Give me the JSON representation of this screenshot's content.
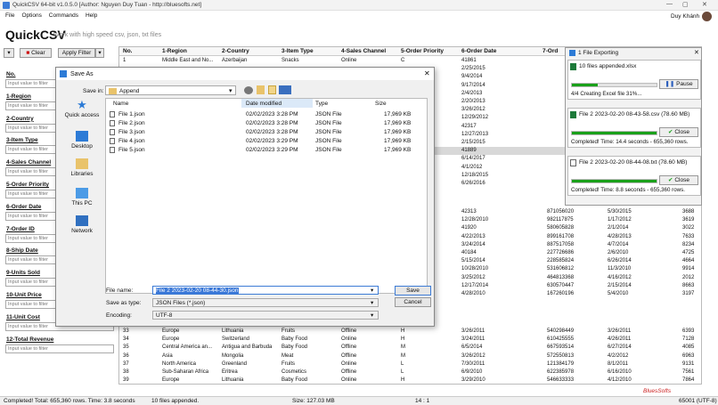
{
  "window": {
    "title": "QuickCSV 64-bit v1.0.5.0 [Author: Nguyen Duy Tuan - http://bluesofts.net]"
  },
  "menu": [
    "File",
    "Options",
    "Commands",
    "Help"
  ],
  "user": {
    "name": "Duy Khánh"
  },
  "app": {
    "brand": "QuickCSV",
    "slogan": "Work with high speed csv, json, txt files"
  },
  "toolbar": {
    "clear": "Clear",
    "apply": "Apply Filter"
  },
  "filters": {
    "placeholder": "Input value to filter",
    "fields": [
      "No.",
      "1-Region",
      "2-Country",
      "3-Item Type",
      "4-Sales Channel",
      "5-Order Priority",
      "6-Order Date",
      "7-Order ID",
      "8-Ship Date",
      "9-Units Sold",
      "10-Unit Price",
      "11-Unit Cost",
      "12-Total Revenue"
    ]
  },
  "grid": {
    "columns": [
      "No.",
      "1-Region",
      "2-Country",
      "3-Item Type",
      "4-Sales Channel",
      "5-Order Priority",
      "6-Order Date",
      "7-Ord"
    ],
    "top_rows": [
      [
        "1",
        "Middle East and No...",
        "Azerbaijan",
        "Snacks",
        "Online",
        "C",
        "41861"
      ],
      [
        "",
        "",
        "",
        "",
        "",
        "",
        "2/25/2015"
      ],
      [
        "",
        "",
        "",
        "",
        "",
        "",
        "9/4/2014"
      ],
      [
        "",
        "",
        "",
        "",
        "",
        "",
        "9/17/2014"
      ],
      [
        "",
        "",
        "",
        "",
        "",
        "",
        "2/4/2013"
      ],
      [
        "",
        "",
        "",
        "",
        "",
        "",
        "2/20/2013"
      ],
      [
        "",
        "",
        "",
        "",
        "",
        "",
        "3/26/2012"
      ],
      [
        "",
        "",
        "",
        "",
        "",
        "",
        "12/29/2012"
      ],
      [
        "",
        "",
        "",
        "",
        "",
        "",
        "42317"
      ],
      [
        "",
        "",
        "",
        "",
        "",
        "",
        "12/27/2013"
      ],
      [
        "",
        "",
        "",
        "",
        "",
        "",
        "2/15/2015"
      ],
      [
        "",
        "",
        "",
        "",
        "",
        "",
        "41889"
      ],
      [
        "",
        "",
        "",
        "",
        "",
        "",
        "6/14/2017"
      ],
      [
        "",
        "",
        "",
        "",
        "",
        "",
        "4/1/2012"
      ],
      [
        "",
        "",
        "",
        "",
        "",
        "",
        "12/18/2015"
      ],
      [
        "",
        "",
        "",
        "",
        "",
        "",
        "6/26/2016"
      ]
    ],
    "mid_rows": [
      [
        "",
        "",
        "",
        "",
        "",
        "",
        "42313",
        "871056020",
        "5/30/2015",
        "3688"
      ],
      [
        "",
        "",
        "",
        "",
        "",
        "",
        "12/28/2010",
        "982117875",
        "1/17/2012",
        "3619"
      ],
      [
        "",
        "",
        "",
        "",
        "",
        "",
        "41920",
        "580605828",
        "2/1/2014",
        "3022"
      ],
      [
        "",
        "",
        "",
        "",
        "",
        "",
        "4/22/2013",
        "899161708",
        "4/28/2013",
        "7633"
      ],
      [
        "",
        "",
        "",
        "",
        "",
        "",
        "3/24/2014",
        "887517058",
        "4/7/2014",
        "8234"
      ],
      [
        "",
        "",
        "",
        "",
        "",
        "",
        "40184",
        "227726686",
        "2/6/2010",
        "4725"
      ],
      [
        "",
        "",
        "",
        "",
        "",
        "",
        "5/15/2014",
        "228585824",
        "6/26/2014",
        "4664"
      ],
      [
        "",
        "",
        "",
        "",
        "",
        "",
        "10/28/2010",
        "531606812",
        "11/3/2010",
        "9914"
      ],
      [
        "",
        "",
        "",
        "",
        "",
        "",
        "3/25/2012",
        "464813368",
        "4/16/2012",
        "2012"
      ],
      [
        "",
        "",
        "",
        "",
        "",
        "",
        "12/17/2014",
        "630570447",
        "2/15/2014",
        "8663"
      ],
      [
        "",
        "",
        "",
        "",
        "",
        "",
        "4/28/2010",
        "167260196",
        "5/4/2010",
        "3197"
      ]
    ],
    "bottom_rows": [
      [
        "33",
        "Europe",
        "Lithuania",
        "Fruits",
        "Offline",
        "H",
        "3/26/2011",
        "540298449",
        "3/26/2011",
        "6393"
      ],
      [
        "34",
        "Europe",
        "Switzerland",
        "Baby Food",
        "Online",
        "H",
        "3/24/2011",
        "610425555",
        "4/26/2011",
        "7128"
      ],
      [
        "35",
        "Central America an...",
        "Antigua and Barbuda",
        "Baby Food",
        "Offline",
        "M",
        "6/5/2014",
        "667593514",
        "6/27/2014",
        "4085"
      ],
      [
        "36",
        "Asia",
        "Mongolia",
        "Meat",
        "Offline",
        "M",
        "3/26/2012",
        "572550813",
        "4/2/2012",
        "6963"
      ],
      [
        "37",
        "North America",
        "Greenland",
        "Fruits",
        "Online",
        "L",
        "7/30/2011",
        "121384179",
        "8/1/2011",
        "9131"
      ],
      [
        "38",
        "Sub-Saharan Africa",
        "Eritrea",
        "Cosmetics",
        "Offline",
        "L",
        "6/9/2010",
        "622385978",
        "6/16/2010",
        "7561"
      ],
      [
        "39",
        "Europe",
        "Lithuania",
        "Baby Food",
        "Online",
        "H",
        "3/29/2010",
        "546633333",
        "4/12/2010",
        "7864"
      ]
    ]
  },
  "status": {
    "completed": "Completed! Total: 655,360 rows. Time: 3.8 seconds",
    "appended": "10 files appended.",
    "size": "Size: 127.03 MB",
    "pos": "14 : 1",
    "enc": "65001 (UTF-8)",
    "watermark": "BluesSofts"
  },
  "dialog": {
    "title": "Save As",
    "save_in_label": "Save in:",
    "save_in": "Append",
    "places": [
      "Quick access",
      "Desktop",
      "Libraries",
      "This PC",
      "Network"
    ],
    "col_name": "Name",
    "col_date": "Date modified",
    "col_type": "Type",
    "col_size": "Size",
    "files": [
      [
        "File 1.json",
        "02/02/2023 3:28 PM",
        "JSON File",
        "17,969 KB"
      ],
      [
        "File 2.json",
        "02/02/2023 3:28 PM",
        "JSON File",
        "17,969 KB"
      ],
      [
        "File 3.json",
        "02/02/2023 3:28 PM",
        "JSON File",
        "17,969 KB"
      ],
      [
        "File 4.json",
        "02/02/2023 3:29 PM",
        "JSON File",
        "17,969 KB"
      ],
      [
        "File 5.json",
        "02/02/2023 3:29 PM",
        "JSON File",
        "17,969 KB"
      ]
    ],
    "filename_label": "File name:",
    "filename": "File 2 2023-02-20 08-44-30.json",
    "type_label": "Save as type:",
    "type": "JSON Files (*.json)",
    "enc_label": "Encoding:",
    "enc": "UTF-8",
    "save": "Save",
    "cancel": "Cancel"
  },
  "export": {
    "title": "1 File Exporting",
    "c1_title": "10 files appended.xlsx",
    "c1_status": "4/4 Creating Excel file 31%...",
    "pause": "Pause",
    "c1_progress": 0.31,
    "c2_title": "File 2 2023-02-20 08-43-58.csv (78.60 MB)",
    "c2_status": "Completed! Time: 14.4 seconds - 655,360 rows.",
    "c2_progress": 1,
    "c3_title": "File 2 2023-02-20 08-44-08.txt (78.60 MB)",
    "c3_status": "Completed! Time: 8.8 seconds - 655,360 rows.",
    "c3_progress": 1,
    "close": "Close"
  }
}
